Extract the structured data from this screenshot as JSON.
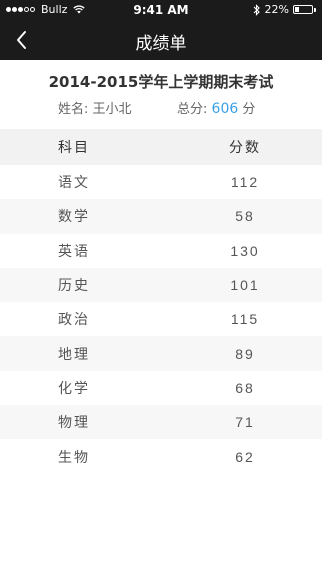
{
  "status_bar": {
    "carrier": "Bullz",
    "time": "9:41 AM",
    "battery_percent": "22%",
    "battery_level": 0.22
  },
  "nav": {
    "title": "成绩单",
    "back_icon": "chevron-left-icon"
  },
  "exam": {
    "title": "2014-2015学年上学期期末考试",
    "name_label": "姓名:",
    "name_value": "王小北",
    "total_label": "总分:",
    "total_value": "606",
    "total_unit": "分"
  },
  "table": {
    "headers": {
      "subject": "科目",
      "score": "分数"
    },
    "rows": [
      {
        "subject": "语文",
        "score": "112"
      },
      {
        "subject": "数学",
        "score": "58"
      },
      {
        "subject": "英语",
        "score": "130"
      },
      {
        "subject": "历史",
        "score": "101"
      },
      {
        "subject": "政治",
        "score": "115"
      },
      {
        "subject": "地理",
        "score": "89"
      },
      {
        "subject": "化学",
        "score": "68"
      },
      {
        "subject": "物理",
        "score": "71"
      },
      {
        "subject": "生物",
        "score": "62"
      }
    ]
  },
  "colors": {
    "navbar_bg": "#1b1b1b",
    "accent": "#3aa0e6",
    "header_row_bg": "#f2f2f2",
    "alt_row_bg": "#f7f7f7"
  }
}
